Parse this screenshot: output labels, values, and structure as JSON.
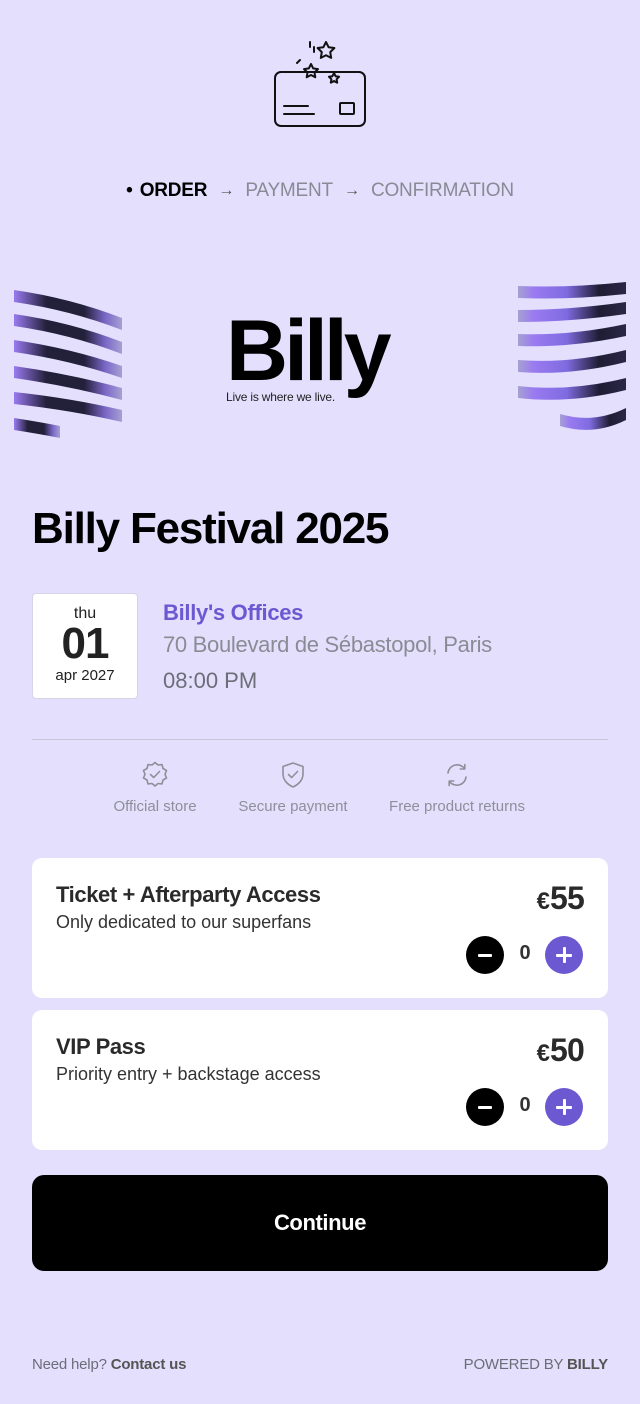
{
  "steps": {
    "dot": "•",
    "order": "ORDER",
    "arrow": "→",
    "payment": "PAYMENT",
    "confirmation": "CONFIRMATION"
  },
  "brand": {
    "logo_text": "Billy",
    "tagline": "Live is where we live."
  },
  "event": {
    "title": "Billy Festival 2025",
    "date": {
      "weekday": "thu",
      "day": "01",
      "month_year": "apr 2027"
    },
    "venue_name": "Billy's Offices",
    "address": "70 Boulevard de Sébastopol, Paris",
    "time": "08:00 PM"
  },
  "features": [
    {
      "icon": "verified-badge-icon",
      "label": "Official store"
    },
    {
      "icon": "shield-check-icon",
      "label": "Secure payment"
    },
    {
      "icon": "refresh-icon",
      "label": "Free product returns"
    }
  ],
  "tickets": [
    {
      "name": "Ticket + Afterparty Access",
      "description": "Only dedicated to our superfans",
      "currency": "€",
      "price": "55",
      "quantity": "0"
    },
    {
      "name": "VIP Pass",
      "description": "Priority entry + backstage access",
      "currency": "€",
      "price": "50",
      "quantity": "0"
    }
  ],
  "continue_label": "Continue",
  "footer": {
    "help_text": "Need help?",
    "contact_label": "Contact us",
    "powered_by": "POWERED BY",
    "powered_brand": "BILLY"
  },
  "colors": {
    "background": "#e3dffd",
    "accent": "#6c58d1",
    "button": "#000000"
  }
}
